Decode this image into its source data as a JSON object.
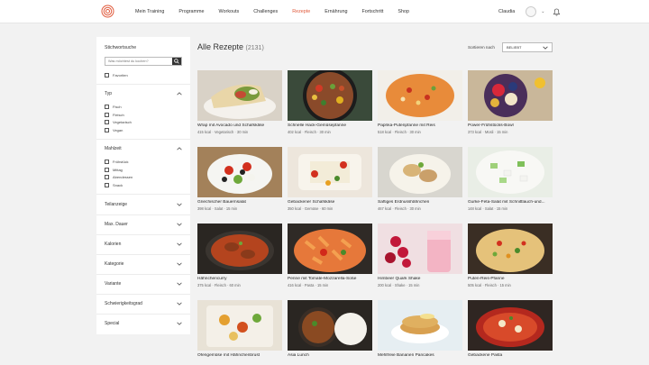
{
  "header": {
    "nav": [
      "Mein Training",
      "Programme",
      "Workouts",
      "Challenges",
      "Rezepte",
      "Ernährung",
      "Fortschritt",
      "Shop"
    ],
    "active_index": 4,
    "user_name": "Claudia"
  },
  "sidebar": {
    "search_title": "Stichwortsuche",
    "search_placeholder": "Was möchtest du kochen?",
    "favorites_label": "Favoriten",
    "sections": [
      {
        "label": "Typ",
        "expanded": true,
        "options": [
          "Fisch",
          "Fleisch",
          "Vegetarisch",
          "Vegan"
        ]
      },
      {
        "label": "Mahlzeit",
        "expanded": true,
        "options": [
          "Frühstück",
          "Mittag",
          "Abendessen",
          "Snack"
        ]
      },
      {
        "label": "Teilanzeige",
        "expanded": false
      },
      {
        "label": "Max. Dauer",
        "expanded": false
      },
      {
        "label": "Kalorien",
        "expanded": false
      },
      {
        "label": "Kategorie",
        "expanded": false
      },
      {
        "label": "Variante",
        "expanded": false
      },
      {
        "label": "Schwierigkeitsgrad",
        "expanded": false
      },
      {
        "label": "Special",
        "expanded": false
      }
    ]
  },
  "main": {
    "title": "Alle Rezepte",
    "count": "(2131)",
    "sort_label": "Sortieren nach",
    "sort_value": "BELIEBT"
  },
  "recipes": [
    {
      "title": "Wrap mit Avocado und Schafskäse",
      "meta": "415 kcal · Vegetarisch · 30 min",
      "image": "wrap-photo"
    },
    {
      "title": "Schnelle Hack-Gemüsepfanne",
      "meta": "402 kcal · Fleisch · 30 min",
      "image": "pan-photo"
    },
    {
      "title": "Paprika-Putenpfanne mit Reis",
      "meta": "518 kcal · Fleisch · 30 min",
      "image": "rice-pan-photo"
    },
    {
      "title": "Power-Frühstücks-Bowl",
      "meta": "373 kcal · Müsli · 15 min",
      "image": "bowl-photo"
    },
    {
      "title": "Griechischer Bauernsalat",
      "meta": "398 kcal · Salat · 15 min",
      "image": "greek-salad-photo"
    },
    {
      "title": "Gebackener Schafskäse",
      "meta": "350 kcal · Gemüse · 60 min",
      "image": "baked-feta-photo"
    },
    {
      "title": "Saftiges Erdnusshähnchen",
      "meta": "467 kcal · Fleisch · 30 min",
      "image": "peanut-chicken-photo"
    },
    {
      "title": "Gurke-Feta-Salat mit Schnittlauch-und...",
      "meta": "148 kcal · Salat · 15 min",
      "image": "cucumber-salad-photo"
    },
    {
      "title": "Hähnchencurry",
      "meta": "375 kcal · Fleisch · 60 min",
      "image": "curry-photo"
    },
    {
      "title": "Penne mit Tomate-Mozzarella-Soße",
      "meta": "416 kcal · Pasta · 15 min",
      "image": "penne-photo"
    },
    {
      "title": "Himbeer Quark Shake",
      "meta": "200 kcal · Shake · 15 min",
      "image": "shake-photo"
    },
    {
      "title": "Puten-Reis-Pfanne",
      "meta": "505 kcal · Fleisch · 15 min",
      "image": "turkey-rice-photo"
    },
    {
      "title": "Ofengemüse mit Hähnchenbrust",
      "meta": "",
      "image": "oven-veg-photo"
    },
    {
      "title": "Asia Lunch",
      "meta": "",
      "image": "asia-lunch-photo"
    },
    {
      "title": "Mehlfreie Bananen Pancakes",
      "meta": "",
      "image": "pancakes-photo"
    },
    {
      "title": "Gebackene Pasta",
      "meta": "",
      "image": "baked-pasta-photo"
    }
  ],
  "colors": {
    "accent": "#e05a3c",
    "page_bg": "#f2f2f2"
  }
}
